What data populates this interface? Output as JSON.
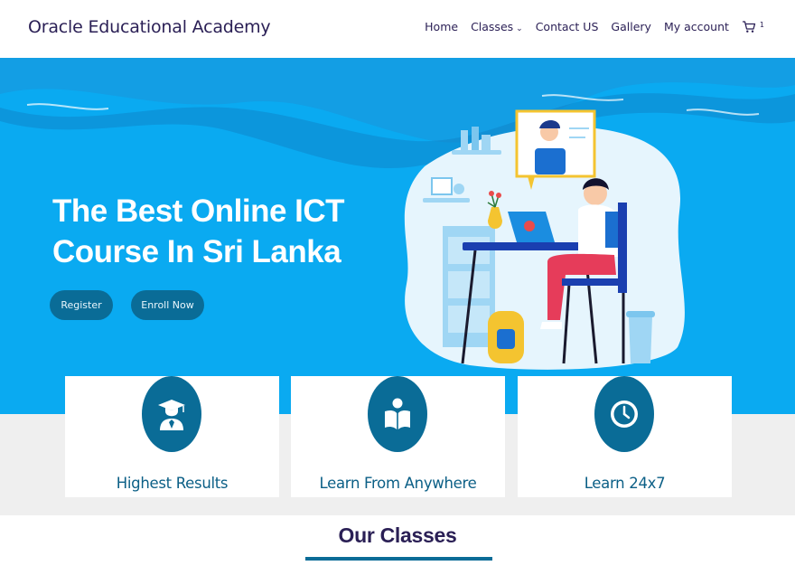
{
  "header": {
    "brand": "Oracle Educational Academy",
    "nav": [
      {
        "label": "Home"
      },
      {
        "label": "Classes",
        "has_dropdown": true
      },
      {
        "label": "Contact US"
      },
      {
        "label": "Gallery"
      },
      {
        "label": "My account"
      }
    ],
    "cart_count": "1"
  },
  "hero": {
    "title_line1": "The Best Online ICT",
    "title_line2": "Course In Sri Lanka",
    "register_label": "Register",
    "enroll_label": "Enroll Now"
  },
  "features": [
    {
      "label": "Highest Results",
      "icon": "graduate-icon"
    },
    {
      "label": "Learn From Anywhere",
      "icon": "reading-icon"
    },
    {
      "label": "Learn 24x7",
      "icon": "clock-icon"
    }
  ],
  "section": {
    "title": "Our Classes"
  },
  "colors": {
    "hero_bg": "#0aaaf1",
    "accent": "#0a6c97",
    "heading": "#2a1f55"
  }
}
